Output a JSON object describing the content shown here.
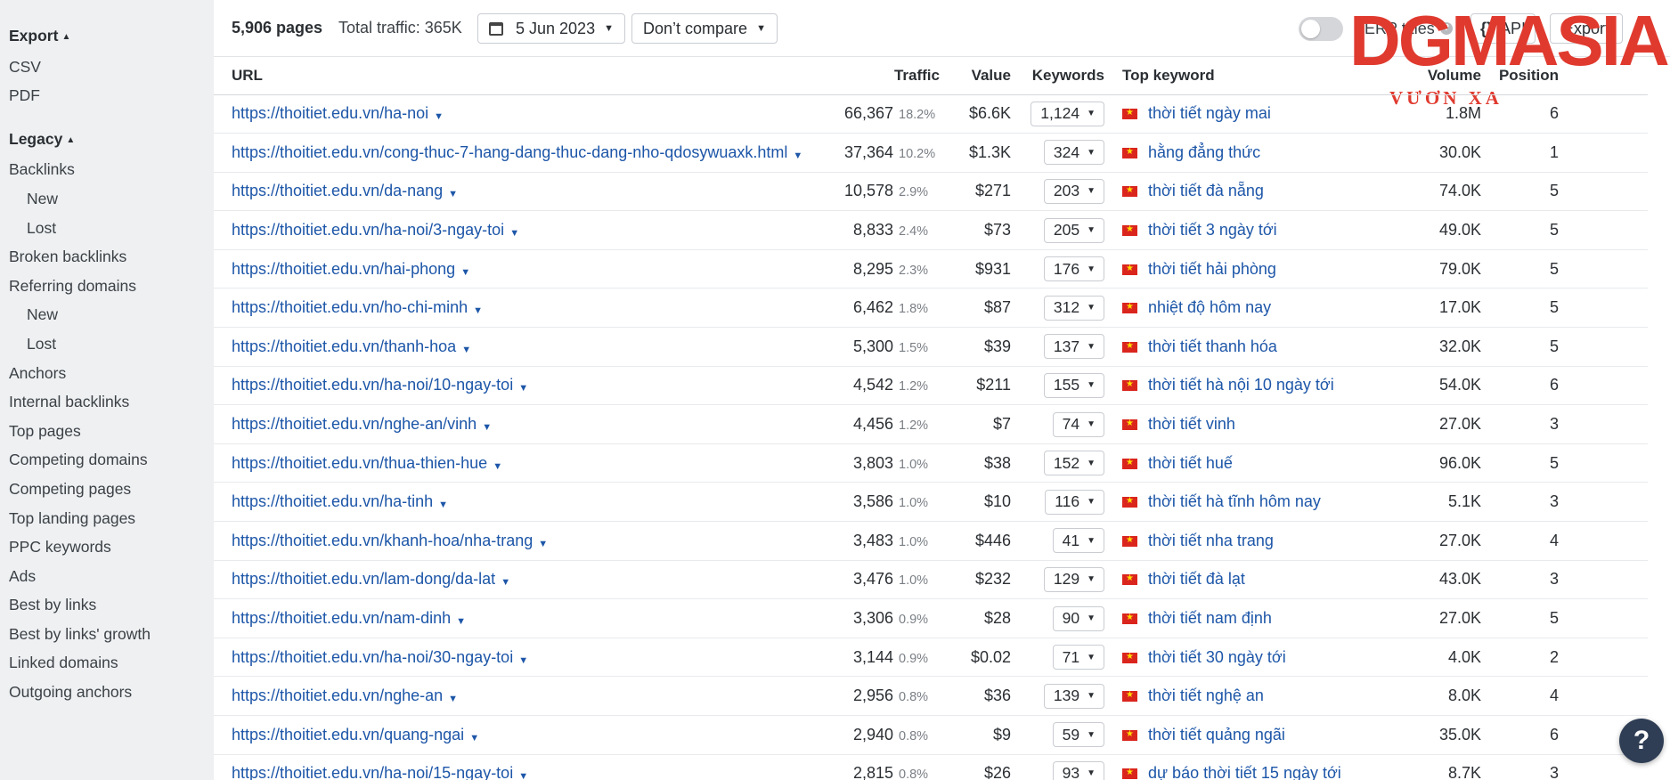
{
  "sidebar": {
    "export_label": "Export",
    "export_items": [
      "CSV",
      "PDF"
    ],
    "legacy_label": "Legacy",
    "legacy_items": [
      {
        "label": "Backlinks",
        "sub": false
      },
      {
        "label": "New",
        "sub": true
      },
      {
        "label": "Lost",
        "sub": true
      },
      {
        "label": "Broken backlinks",
        "sub": false
      },
      {
        "label": "Referring domains",
        "sub": false
      },
      {
        "label": "New",
        "sub": true
      },
      {
        "label": "Lost",
        "sub": true
      },
      {
        "label": "Anchors",
        "sub": false
      },
      {
        "label": "Internal backlinks",
        "sub": false
      },
      {
        "label": "Top pages",
        "sub": false
      },
      {
        "label": "Competing domains",
        "sub": false
      },
      {
        "label": "Competing pages",
        "sub": false
      },
      {
        "label": "Top landing pages",
        "sub": false
      },
      {
        "label": "PPC keywords",
        "sub": false
      },
      {
        "label": "Ads",
        "sub": false
      },
      {
        "label": "Best by links",
        "sub": false
      },
      {
        "label": "Best by links' growth",
        "sub": false
      },
      {
        "label": "Linked domains",
        "sub": false
      },
      {
        "label": "Outgoing anchors",
        "sub": false
      }
    ]
  },
  "toolbar": {
    "pages_count": "5,906 pages",
    "total_traffic": "Total traffic: 365K",
    "date": "5 Jun 2023",
    "compare": "Don’t compare",
    "serp_titles": "SERP titles",
    "api_label": "API",
    "export_label": "Export"
  },
  "logo": {
    "text": "DGMASIA",
    "tagline": "VƯƠN XA"
  },
  "table": {
    "headers": {
      "url": "URL",
      "traffic": "Traffic",
      "value": "Value",
      "keywords": "Keywords",
      "top_keyword": "Top keyword",
      "volume": "Volume",
      "position": "Position"
    },
    "rows": [
      {
        "url": "https://thoitiet.edu.vn/ha-noi",
        "traffic": "66,367",
        "pct": "18.2%",
        "value": "$6.6K",
        "keywords": "1,124",
        "top_keyword": "thời tiết ngày mai",
        "volume": "1.8M",
        "position": "6"
      },
      {
        "url": "https://thoitiet.edu.vn/cong-thuc-7-hang-dang-thuc-dang-nho-qdosywuaxk.html",
        "traffic": "37,364",
        "pct": "10.2%",
        "value": "$1.3K",
        "keywords": "324",
        "top_keyword": "hằng đẳng thức",
        "volume": "30.0K",
        "position": "1"
      },
      {
        "url": "https://thoitiet.edu.vn/da-nang",
        "traffic": "10,578",
        "pct": "2.9%",
        "value": "$271",
        "keywords": "203",
        "top_keyword": "thời tiết đà nẵng",
        "volume": "74.0K",
        "position": "5"
      },
      {
        "url": "https://thoitiet.edu.vn/ha-noi/3-ngay-toi",
        "traffic": "8,833",
        "pct": "2.4%",
        "value": "$73",
        "keywords": "205",
        "top_keyword": "thời tiết 3 ngày tới",
        "volume": "49.0K",
        "position": "5"
      },
      {
        "url": "https://thoitiet.edu.vn/hai-phong",
        "traffic": "8,295",
        "pct": "2.3%",
        "value": "$931",
        "keywords": "176",
        "top_keyword": "thời tiết hải phòng",
        "volume": "79.0K",
        "position": "5"
      },
      {
        "url": "https://thoitiet.edu.vn/ho-chi-minh",
        "traffic": "6,462",
        "pct": "1.8%",
        "value": "$87",
        "keywords": "312",
        "top_keyword": "nhiệt độ hôm nay",
        "volume": "17.0K",
        "position": "5"
      },
      {
        "url": "https://thoitiet.edu.vn/thanh-hoa",
        "traffic": "5,300",
        "pct": "1.5%",
        "value": "$39",
        "keywords": "137",
        "top_keyword": "thời tiết thanh hóa",
        "volume": "32.0K",
        "position": "5"
      },
      {
        "url": "https://thoitiet.edu.vn/ha-noi/10-ngay-toi",
        "traffic": "4,542",
        "pct": "1.2%",
        "value": "$211",
        "keywords": "155",
        "top_keyword": "thời tiết hà nội 10 ngày tới",
        "volume": "54.0K",
        "position": "6"
      },
      {
        "url": "https://thoitiet.edu.vn/nghe-an/vinh",
        "traffic": "4,456",
        "pct": "1.2%",
        "value": "$7",
        "keywords": "74",
        "top_keyword": "thời tiết vinh",
        "volume": "27.0K",
        "position": "3"
      },
      {
        "url": "https://thoitiet.edu.vn/thua-thien-hue",
        "traffic": "3,803",
        "pct": "1.0%",
        "value": "$38",
        "keywords": "152",
        "top_keyword": "thời tiết huế",
        "volume": "96.0K",
        "position": "5"
      },
      {
        "url": "https://thoitiet.edu.vn/ha-tinh",
        "traffic": "3,586",
        "pct": "1.0%",
        "value": "$10",
        "keywords": "116",
        "top_keyword": "thời tiết hà tĩnh hôm nay",
        "volume": "5.1K",
        "position": "3"
      },
      {
        "url": "https://thoitiet.edu.vn/khanh-hoa/nha-trang",
        "traffic": "3,483",
        "pct": "1.0%",
        "value": "$446",
        "keywords": "41",
        "top_keyword": "thời tiết nha trang",
        "volume": "27.0K",
        "position": "4"
      },
      {
        "url": "https://thoitiet.edu.vn/lam-dong/da-lat",
        "traffic": "3,476",
        "pct": "1.0%",
        "value": "$232",
        "keywords": "129",
        "top_keyword": "thời tiết đà lạt",
        "volume": "43.0K",
        "position": "3"
      },
      {
        "url": "https://thoitiet.edu.vn/nam-dinh",
        "traffic": "3,306",
        "pct": "0.9%",
        "value": "$28",
        "keywords": "90",
        "top_keyword": "thời tiết nam định",
        "volume": "27.0K",
        "position": "5"
      },
      {
        "url": "https://thoitiet.edu.vn/ha-noi/30-ngay-toi",
        "traffic": "3,144",
        "pct": "0.9%",
        "value": "$0.02",
        "keywords": "71",
        "top_keyword": "thời tiết 30 ngày tới",
        "volume": "4.0K",
        "position": "2"
      },
      {
        "url": "https://thoitiet.edu.vn/nghe-an",
        "traffic": "2,956",
        "pct": "0.8%",
        "value": "$36",
        "keywords": "139",
        "top_keyword": "thời tiết nghệ an",
        "volume": "8.0K",
        "position": "4"
      },
      {
        "url": "https://thoitiet.edu.vn/quang-ngai",
        "traffic": "2,940",
        "pct": "0.8%",
        "value": "$9",
        "keywords": "59",
        "top_keyword": "thời tiết quảng ngãi",
        "volume": "35.0K",
        "position": "6"
      },
      {
        "url": "https://thoitiet.edu.vn/ha-noi/15-ngay-toi",
        "traffic": "2,815",
        "pct": "0.8%",
        "value": "$26",
        "keywords": "93",
        "top_keyword": "dự báo thời tiết 15 ngày tới",
        "volume": "8.7K",
        "position": "3"
      }
    ]
  },
  "help_label": "?",
  "colors": {
    "link": "#1d56a8",
    "sidebar_bg": "#eef0f2",
    "logo_red": "#e03a2f",
    "help_bg": "#2f3e55"
  },
  "icons": {
    "calendar": "calendar-icon",
    "dropdown": "chevron-down-icon",
    "flag": "vietnam-flag-icon",
    "help": "help-icon",
    "api": "code-braces-icon"
  }
}
